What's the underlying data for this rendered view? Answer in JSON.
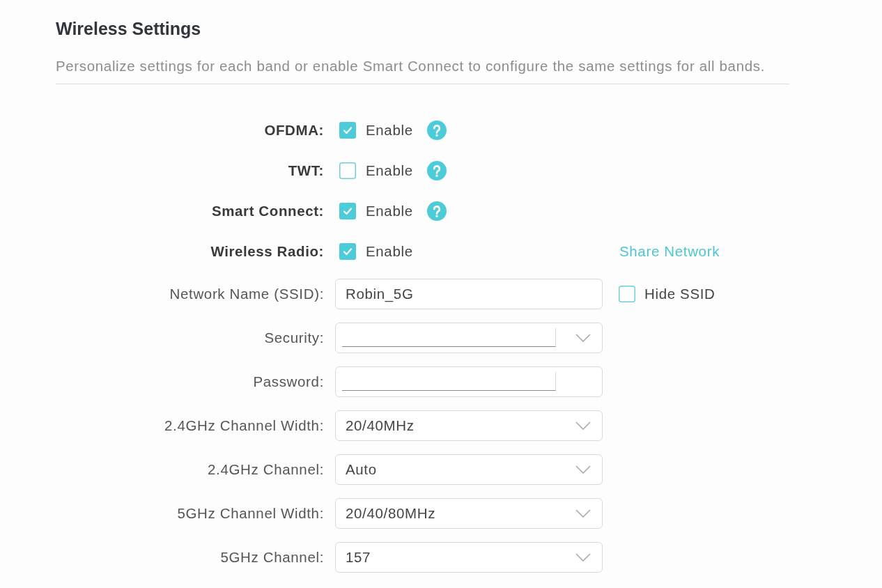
{
  "section": {
    "title": "Wireless Settings",
    "description": "Personalize settings for each band or enable Smart Connect to configure the same settings for all bands."
  },
  "rows": [
    {
      "kind": "checkbox",
      "label": "OFDMA:",
      "checked": true,
      "option": "Enable",
      "help": true
    },
    {
      "kind": "checkbox",
      "label": "TWT:",
      "checked": false,
      "option": "Enable",
      "help": true
    },
    {
      "kind": "checkbox",
      "label": "Smart Connect:",
      "checked": true,
      "option": "Enable",
      "help": true
    },
    {
      "kind": "checkbox",
      "label": "Wireless Radio:",
      "checked": true,
      "option": "Enable",
      "help": false,
      "extra": {
        "kind": "link",
        "label": "Share Network"
      }
    },
    {
      "kind": "text",
      "label": "Network Name (SSID):",
      "value": "Robin_5G",
      "redacted": false,
      "extra": {
        "kind": "checkbox",
        "label": "Hide SSID",
        "checked": false
      }
    },
    {
      "kind": "select",
      "label": "Security:",
      "redacted": true
    },
    {
      "kind": "password",
      "label": "Password:",
      "redacted": true
    },
    {
      "kind": "select",
      "label": "2.4GHz Channel Width:",
      "value": "20/40MHz",
      "redacted": false
    },
    {
      "kind": "select",
      "label": "2.4GHz Channel:",
      "value": "Auto",
      "redacted": false
    },
    {
      "kind": "select",
      "label": "5GHz Channel Width:",
      "value": "20/40/80MHz",
      "redacted": false
    },
    {
      "kind": "select",
      "label": "5GHz Channel:",
      "value": "157",
      "redacted": false
    }
  ]
}
